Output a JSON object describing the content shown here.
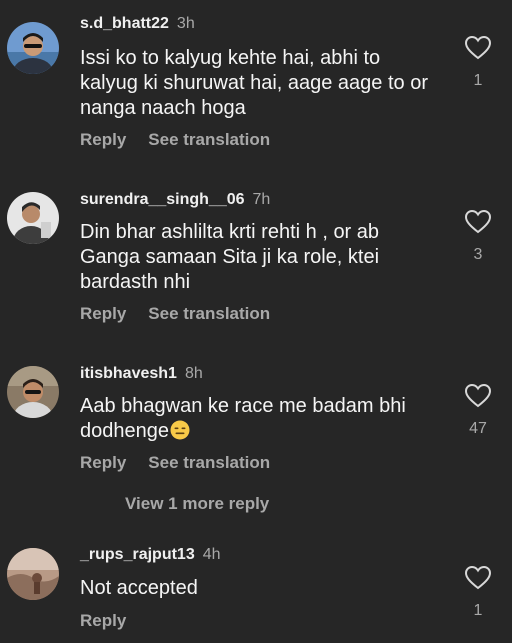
{
  "comments": [
    {
      "username": "s.d_bhatt22",
      "time": "3h",
      "text": "Issi ko to kalyug kehte hai, abhi to kalyug ki shuruwat hai, aage aage to or nanga naach hoga",
      "reply_label": "Reply",
      "translate_label": "See translation",
      "likes": "1"
    },
    {
      "username": "surendra__singh__06",
      "time": "7h",
      "text": "Din bhar ashlilta krti rehti h , or ab Ganga samaan Sita ji ka role, ktei bardasth nhi",
      "reply_label": "Reply",
      "translate_label": "See translation",
      "likes": "3"
    },
    {
      "username": "itisbhavesh1",
      "time": "8h",
      "text": "Aab bhagwan ke race me badam bhi dodhenge",
      "emoji": "expressionless-face-emoji",
      "reply_label": "Reply",
      "translate_label": "See translation",
      "likes": "47",
      "view_more": "View 1 more reply"
    },
    {
      "username": "_rups_rajput13",
      "time": "4h",
      "text": "Not accepted",
      "reply_label": "Reply",
      "likes": "1"
    }
  ],
  "colors": {
    "background": "#262626",
    "primary_text": "#f5f5f5",
    "secondary_text": "#a8a8a8"
  }
}
